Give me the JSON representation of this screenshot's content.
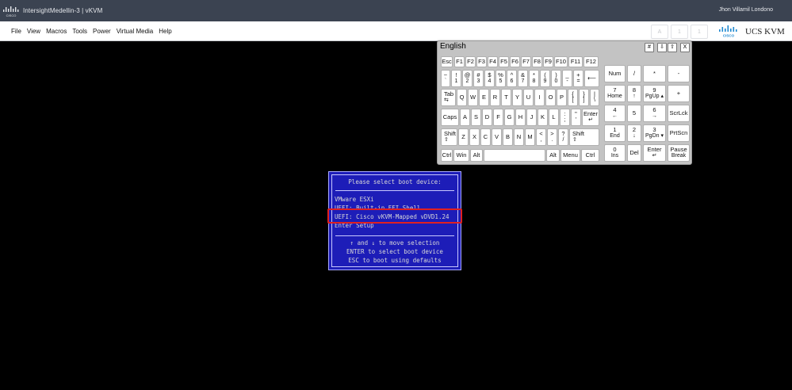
{
  "window": {
    "title": "IntersightMedellin-3 | vKVM",
    "user": "Jhon Villamil Londono"
  },
  "menu": {
    "items": [
      "File",
      "View",
      "Macros",
      "Tools",
      "Power",
      "Virtual Media",
      "Help"
    ],
    "status_icons": [
      "A",
      "1",
      "1"
    ],
    "brand": "UCS KVM"
  },
  "keyboard": {
    "title": "English",
    "controls": [
      "#",
      "⇩",
      "⇧",
      "X"
    ],
    "keys": {
      "esc": "Esc",
      "f1": "F1",
      "f2": "F2",
      "f3": "F3",
      "f4": "F4",
      "f5": "F5",
      "f6": "F6",
      "f7": "F7",
      "f8": "F8",
      "f9": "F9",
      "f10": "F10",
      "f11": "F11",
      "f12": "F12",
      "tilde_top": "~",
      "tilde_bot": "`",
      "n1_top": "!",
      "n1_bot": "1",
      "n2_top": "@",
      "n2_bot": "2",
      "n3_top": "#",
      "n3_bot": "3",
      "n4_top": "$",
      "n4_bot": "4",
      "n5_top": "%",
      "n5_bot": "5",
      "n6_top": "^",
      "n6_bot": "6",
      "n7_top": "&",
      "n7_bot": "7",
      "n8_top": "*",
      "n8_bot": "8",
      "n9_top": "(",
      "n9_bot": "9",
      "n0_top": ")",
      "n0_bot": "0",
      "minus_top": "_",
      "minus_bot": "-",
      "eq_top": "+",
      "eq_bot": "=",
      "backspace": "⟵",
      "tab": "Tab",
      "tab_sub": "⇆",
      "q": "Q",
      "w": "W",
      "e": "E",
      "r": "R",
      "t": "T",
      "y": "Y",
      "u": "U",
      "i": "I",
      "o": "O",
      "p": "P",
      "lbr_top": "{",
      "lbr_bot": "[",
      "rbr_top": "}",
      "rbr_bot": "]",
      "bsl_top": "|",
      "bsl_bot": "\\",
      "caps": "Caps",
      "a": "A",
      "s": "S",
      "d": "D",
      "f": "F",
      "g": "G",
      "h": "H",
      "j": "J",
      "k": "K",
      "l": "L",
      "semi_top": ":",
      "semi_bot": ";",
      "quote_top": "\"",
      "quote_bot": "'",
      "enter": "Enter",
      "enter_sub": "↵",
      "shift": "Shift",
      "shift_sub": "⇧",
      "z": "Z",
      "x": "X",
      "c": "C",
      "v": "V",
      "b": "B",
      "n": "N",
      "m": "M",
      "comma_top": "<",
      "comma_bot": ",",
      "dot_top": ">",
      "dot_bot": ".",
      "slash_top": "?",
      "slash_bot": "/",
      "ctrl": "Ctrl",
      "win": "Win",
      "alt": "Alt",
      "menu": "Menu",
      "num": "Num",
      "np_div": "/",
      "np_mul": "*",
      "np_sub": "-",
      "np7": "7",
      "np7_sub": "Home",
      "np8": "8",
      "np8_sub": "↑",
      "np9": "9",
      "np9_sub": "PgUp ▴",
      "np_add": "+",
      "np4": "4",
      "np4_sub": "←",
      "np5": "5",
      "np6": "6",
      "np6_sub": "→",
      "scrlck": "ScrLck",
      "np1": "1",
      "np1_sub": "End",
      "np2": "2",
      "np2_sub": "↓",
      "np3": "3",
      "np3_sub": "PgDn ▾",
      "prtscn": "PrtScn",
      "np0": "0",
      "np0_sub": "Ins",
      "del": "Del",
      "np_enter": "Enter",
      "np_enter_sub": "↵",
      "pause": "Pause",
      "pause_sub": "Break"
    }
  },
  "boot_menu": {
    "heading": "Please select boot device:",
    "options": [
      "VMware ESXi",
      "UEFI: Built-in EFI Shell",
      "UEFI: Cisco vKVM-Mapped vDVD1.24",
      "Enter Setup"
    ],
    "help": [
      "↑ and ↓ to move selection",
      "ENTER to select boot device",
      "ESC to boot using defaults"
    ],
    "colors": {
      "background": "#1d1db8",
      "highlight": "#e02020"
    }
  }
}
